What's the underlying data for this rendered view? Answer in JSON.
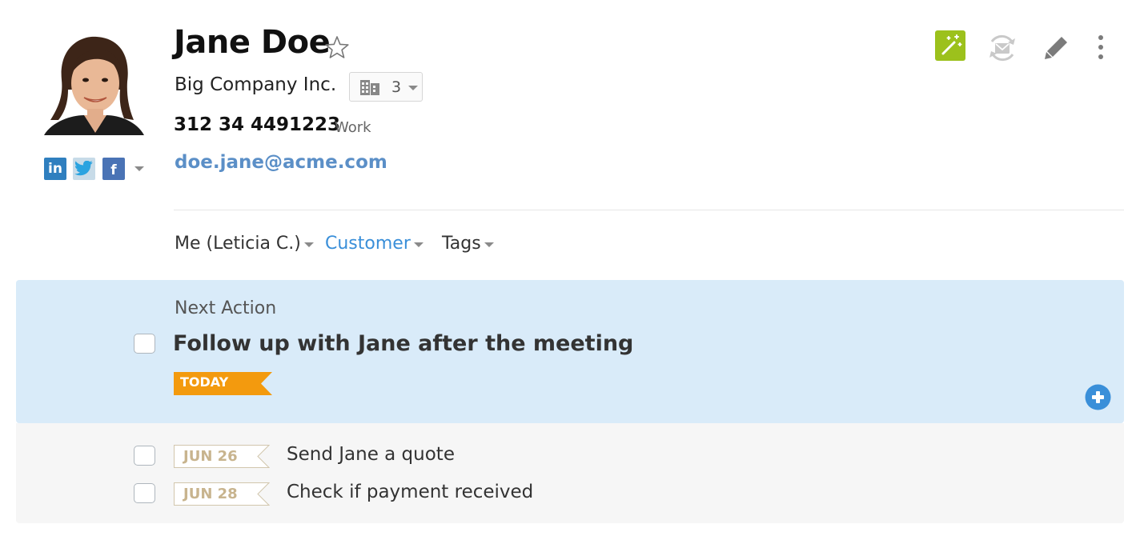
{
  "contact": {
    "name": "Jane Doe",
    "company": "Big Company Inc.",
    "company_count": "3",
    "phone": "312 34 4491223",
    "phone_type": "Work",
    "email": "doe.jane@acme.com"
  },
  "social": {
    "linkedin_glyph": "in",
    "facebook_glyph": "f"
  },
  "meta": {
    "owner": "Me (Leticia C.)",
    "status": "Customer",
    "tags": "Tags"
  },
  "next_action": {
    "heading": "Next Action",
    "title": "Follow up with Jane after the meeting",
    "due_badge": "TODAY"
  },
  "upcoming": [
    {
      "date": "JUN 26",
      "text": "Send Jane a quote"
    },
    {
      "date": "JUN 28",
      "text": "Check if payment received"
    }
  ],
  "colors": {
    "accent_green": "#9cc11c",
    "link_blue": "#5b8fc7",
    "status_blue": "#3a8fd9",
    "today_orange": "#f39a0e",
    "panel_blue": "#d9ebf9"
  }
}
